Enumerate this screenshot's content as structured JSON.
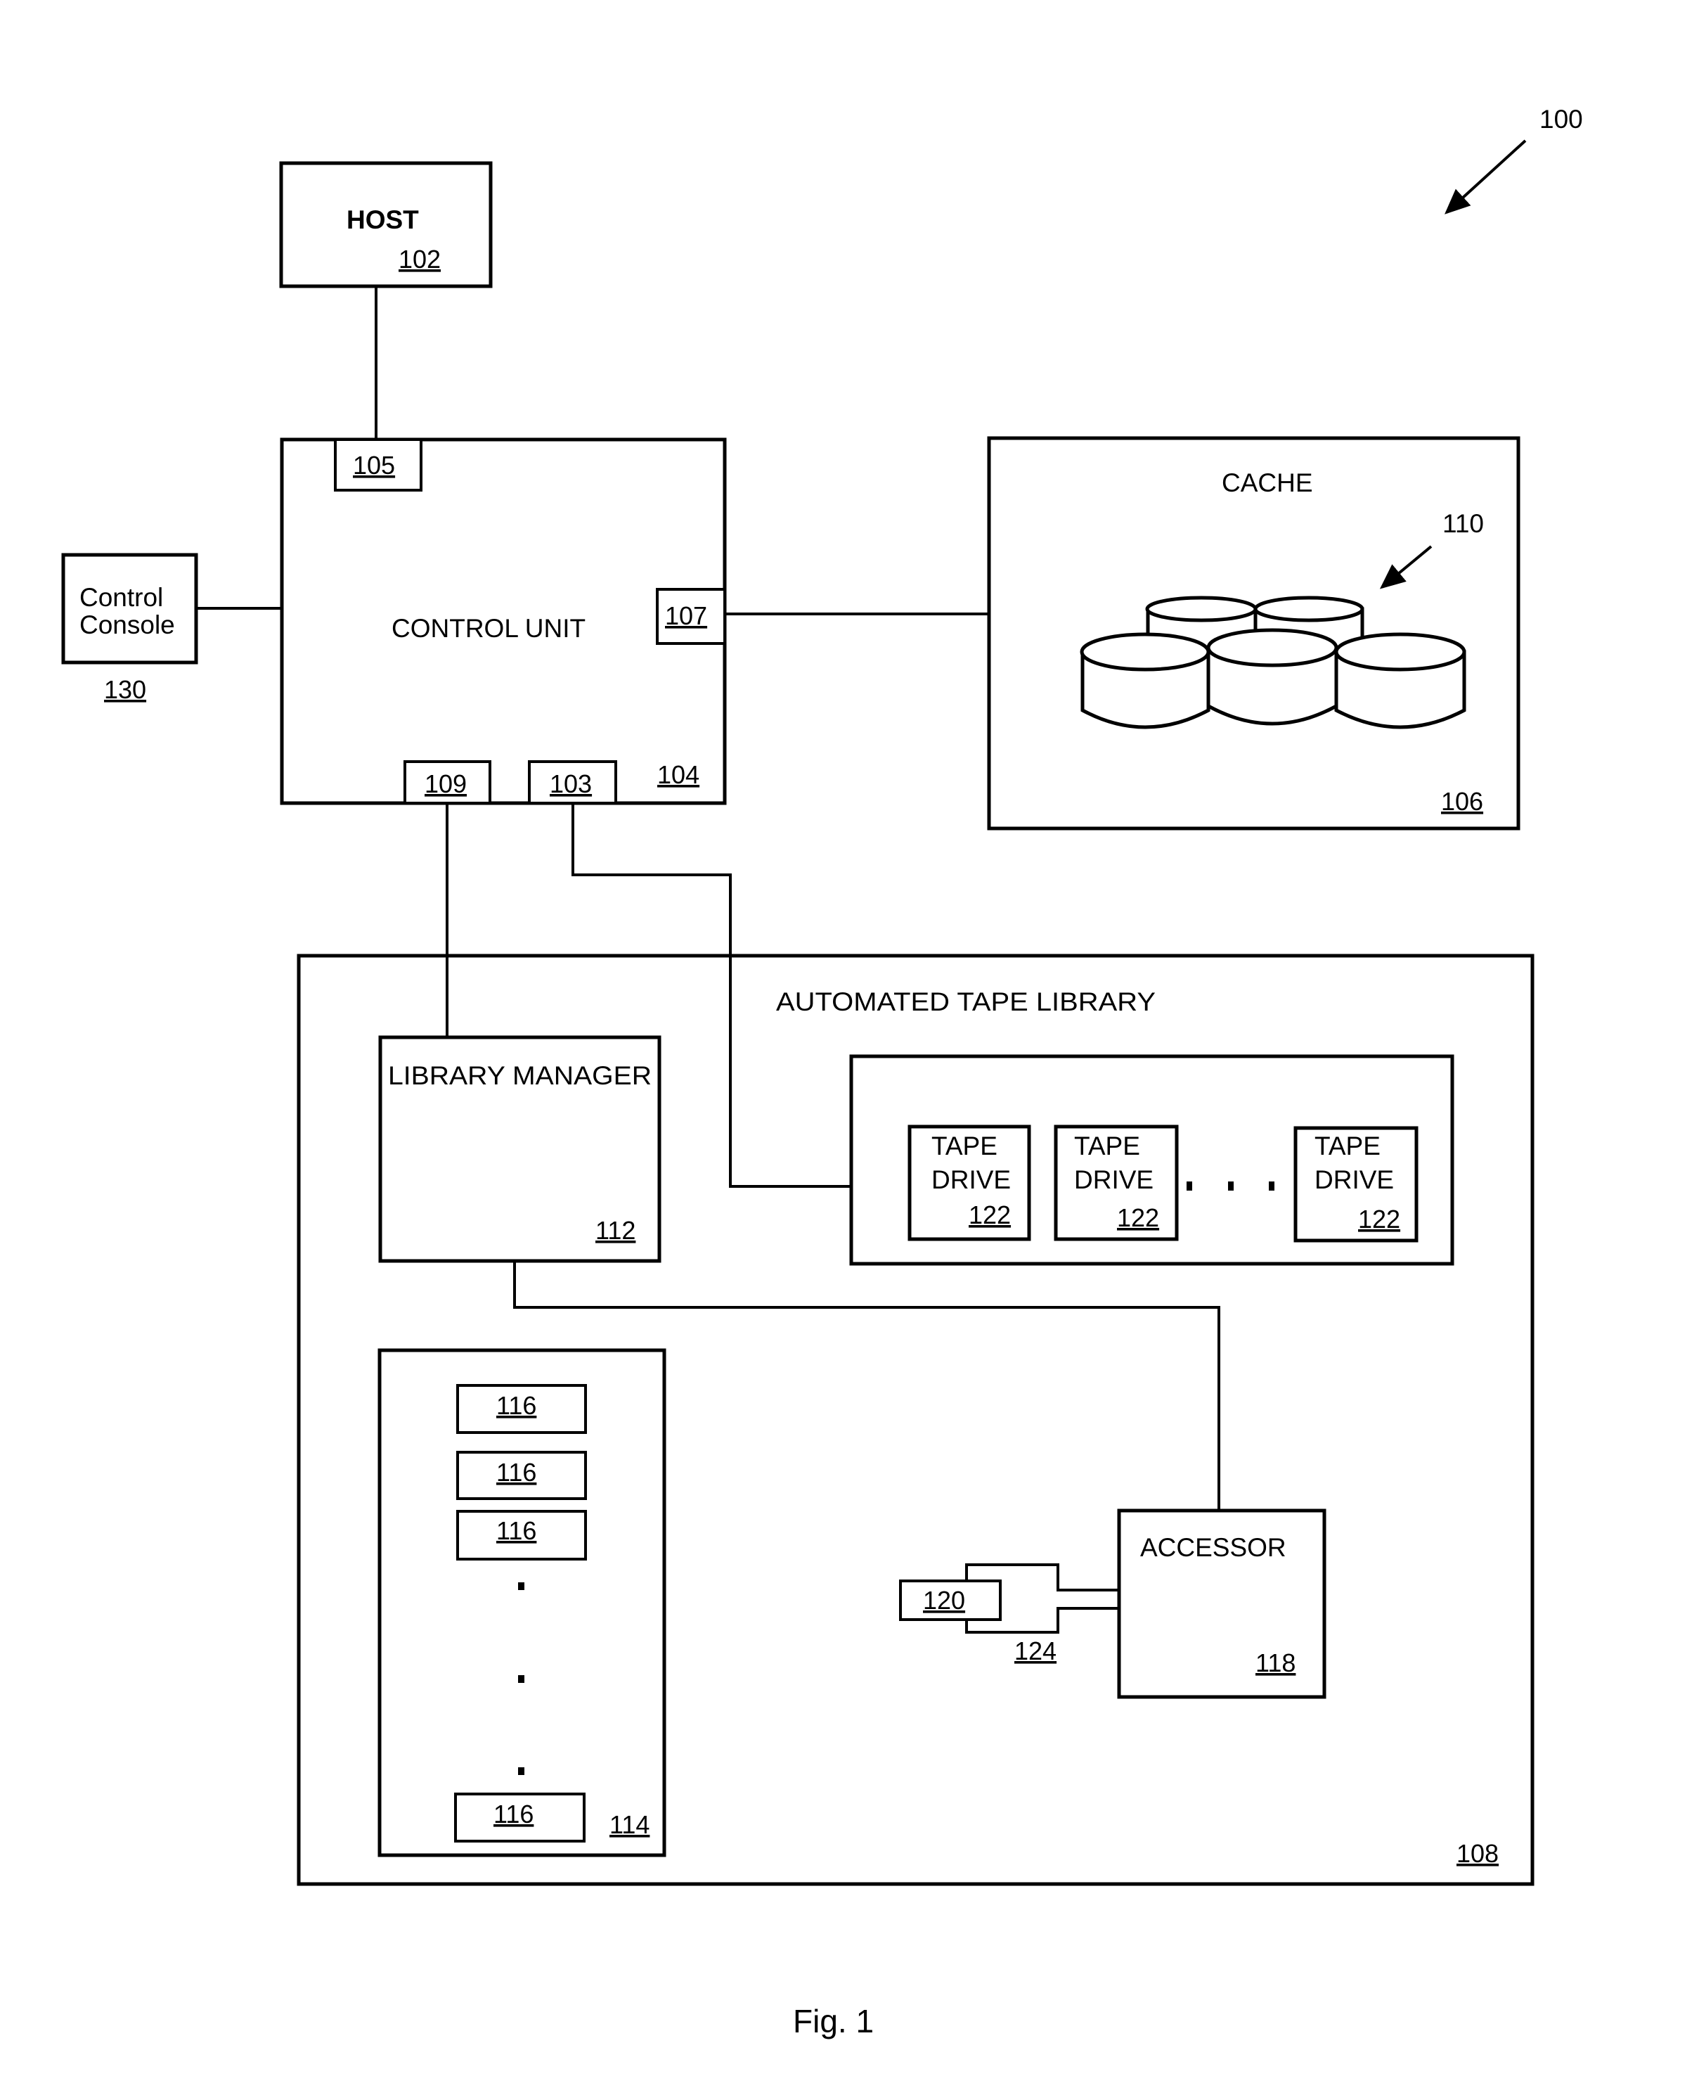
{
  "figure": {
    "caption": "Fig. 1",
    "system_ref": "100"
  },
  "host": {
    "label": "HOST",
    "ref": "102"
  },
  "control_unit": {
    "label": "CONTROL UNIT",
    "ref": "104",
    "ports": {
      "host_port": "105",
      "cache_port": "107",
      "library_manager_port": "109",
      "tape_drive_port": "103"
    }
  },
  "control_console": {
    "label_line1": "Control",
    "label_line2": "Console",
    "ref": "130"
  },
  "cache": {
    "label": "CACHE",
    "ref": "106",
    "disks_ref": "110"
  },
  "tape_library": {
    "label": "AUTOMATED TAPE LIBRARY",
    "ref": "108",
    "library_manager": {
      "label": "LIBRARY MANAGER",
      "ref": "112"
    },
    "tape_drives": [
      {
        "line1": "TAPE",
        "line2": "DRIVE",
        "ref": "122"
      },
      {
        "line1": "TAPE",
        "line2": "DRIVE",
        "ref": "122"
      },
      {
        "line1": "TAPE",
        "line2": "DRIVE",
        "ref": "122"
      }
    ],
    "storage_slots": {
      "ref": "114",
      "slots": [
        "116",
        "116",
        "116",
        "116"
      ]
    },
    "accessor": {
      "label": "ACCESSOR",
      "ref": "118"
    },
    "cartridge": {
      "ref": "120"
    },
    "gripper": {
      "ref": "124"
    }
  }
}
